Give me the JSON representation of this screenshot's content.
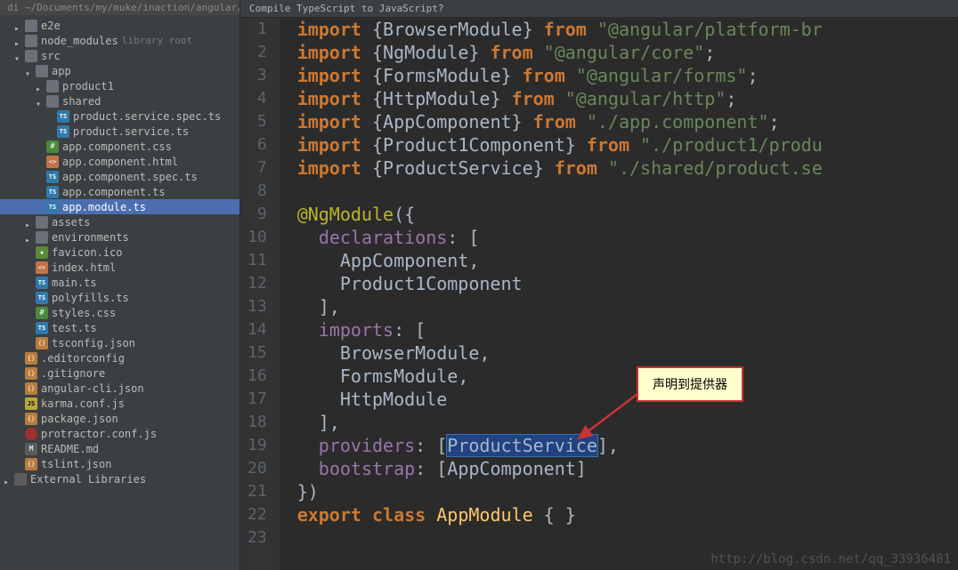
{
  "breadcrumb": "di ~/Documents/my/muke/inaction/angular/code/",
  "hint": "Compile TypeScript to JavaScript?",
  "tree": [
    {
      "label": "e2e",
      "icon": "folder",
      "arrow": "right",
      "indent": 1
    },
    {
      "label": "node_modules",
      "sublabel": "library root",
      "icon": "folder",
      "arrow": "right",
      "indent": 1
    },
    {
      "label": "src",
      "icon": "folder",
      "arrow": "down",
      "indent": 1
    },
    {
      "label": "app",
      "icon": "folder",
      "arrow": "down",
      "indent": 2
    },
    {
      "label": "product1",
      "icon": "folder",
      "arrow": "right",
      "indent": 3
    },
    {
      "label": "shared",
      "icon": "folder",
      "arrow": "down",
      "indent": 3
    },
    {
      "label": "product.service.spec.ts",
      "icon": "ts",
      "arrow": "none",
      "indent": 4
    },
    {
      "label": "product.service.ts",
      "icon": "ts",
      "arrow": "none",
      "indent": 4
    },
    {
      "label": "app.component.css",
      "icon": "css",
      "arrow": "none",
      "indent": 3
    },
    {
      "label": "app.component.html",
      "icon": "html",
      "arrow": "none",
      "indent": 3
    },
    {
      "label": "app.component.spec.ts",
      "icon": "ts",
      "arrow": "none",
      "indent": 3
    },
    {
      "label": "app.component.ts",
      "icon": "ts",
      "arrow": "none",
      "indent": 3
    },
    {
      "label": "app.module.ts",
      "icon": "ts",
      "arrow": "none",
      "indent": 3,
      "selected": true
    },
    {
      "label": "assets",
      "icon": "folder",
      "arrow": "right",
      "indent": 2
    },
    {
      "label": "environments",
      "icon": "folder",
      "arrow": "right",
      "indent": 2
    },
    {
      "label": "favicon.ico",
      "icon": "ico",
      "arrow": "none",
      "indent": 2
    },
    {
      "label": "index.html",
      "icon": "html",
      "arrow": "none",
      "indent": 2
    },
    {
      "label": "main.ts",
      "icon": "ts",
      "arrow": "none",
      "indent": 2
    },
    {
      "label": "polyfills.ts",
      "icon": "ts",
      "arrow": "none",
      "indent": 2
    },
    {
      "label": "styles.css",
      "icon": "css",
      "arrow": "none",
      "indent": 2
    },
    {
      "label": "test.ts",
      "icon": "ts",
      "arrow": "none",
      "indent": 2
    },
    {
      "label": "tsconfig.json",
      "icon": "json",
      "arrow": "none",
      "indent": 2
    },
    {
      "label": ".editorconfig",
      "icon": "json",
      "arrow": "none",
      "indent": 1
    },
    {
      "label": ".gitignore",
      "icon": "json",
      "arrow": "none",
      "indent": 1
    },
    {
      "label": "angular-cli.json",
      "icon": "json",
      "arrow": "none",
      "indent": 1
    },
    {
      "label": "karma.conf.js",
      "icon": "js",
      "arrow": "none",
      "indent": 1
    },
    {
      "label": "package.json",
      "icon": "json",
      "arrow": "none",
      "indent": 1
    },
    {
      "label": "protractor.conf.js",
      "icon": "red",
      "arrow": "none",
      "indent": 1
    },
    {
      "label": "README.md",
      "icon": "md",
      "arrow": "none",
      "indent": 1
    },
    {
      "label": "tslint.json",
      "icon": "json",
      "arrow": "none",
      "indent": 1
    },
    {
      "label": "External Libraries",
      "icon": "lib",
      "arrow": "right",
      "indent": 0
    }
  ],
  "code": {
    "lines": [
      {
        "n": 1,
        "tokens": [
          [
            "kw",
            "import"
          ],
          [
            "punct",
            " {"
          ],
          [
            "ident",
            "BrowserModule"
          ],
          [
            "punct",
            "} "
          ],
          [
            "kw",
            "from"
          ],
          [
            "punct",
            " "
          ],
          [
            "str",
            "\"@angular/platform-br"
          ]
        ]
      },
      {
        "n": 2,
        "tokens": [
          [
            "kw",
            "import"
          ],
          [
            "punct",
            " {"
          ],
          [
            "ident",
            "NgModule"
          ],
          [
            "punct",
            "} "
          ],
          [
            "kw",
            "from"
          ],
          [
            "punct",
            " "
          ],
          [
            "str",
            "\"@angular/core\""
          ],
          [
            "punct",
            ";"
          ]
        ]
      },
      {
        "n": 3,
        "tokens": [
          [
            "kw",
            "import"
          ],
          [
            "punct",
            " {"
          ],
          [
            "ident",
            "FormsModule"
          ],
          [
            "punct",
            "} "
          ],
          [
            "kw",
            "from"
          ],
          [
            "punct",
            " "
          ],
          [
            "str",
            "\"@angular/forms\""
          ],
          [
            "punct",
            ";"
          ]
        ]
      },
      {
        "n": 4,
        "tokens": [
          [
            "kw",
            "import"
          ],
          [
            "punct",
            " {"
          ],
          [
            "ident",
            "HttpModule"
          ],
          [
            "punct",
            "} "
          ],
          [
            "kw",
            "from"
          ],
          [
            "punct",
            " "
          ],
          [
            "str",
            "\"@angular/http\""
          ],
          [
            "punct",
            ";"
          ]
        ]
      },
      {
        "n": 5,
        "tokens": [
          [
            "kw",
            "import"
          ],
          [
            "punct",
            " {"
          ],
          [
            "ident",
            "AppComponent"
          ],
          [
            "punct",
            "} "
          ],
          [
            "kw",
            "from"
          ],
          [
            "punct",
            " "
          ],
          [
            "str",
            "\"./app.component\""
          ],
          [
            "punct",
            ";"
          ]
        ]
      },
      {
        "n": 6,
        "tokens": [
          [
            "kw",
            "import"
          ],
          [
            "punct",
            " {"
          ],
          [
            "ident",
            "Product1Component"
          ],
          [
            "punct",
            "} "
          ],
          [
            "kw",
            "from"
          ],
          [
            "punct",
            " "
          ],
          [
            "str",
            "\"./product1/produ"
          ]
        ]
      },
      {
        "n": 7,
        "tokens": [
          [
            "kw",
            "import"
          ],
          [
            "punct",
            " {"
          ],
          [
            "ident",
            "ProductService"
          ],
          [
            "punct",
            "} "
          ],
          [
            "kw",
            "from"
          ],
          [
            "punct",
            " "
          ],
          [
            "str",
            "\"./shared/product.se"
          ]
        ]
      },
      {
        "n": 8,
        "tokens": []
      },
      {
        "n": 9,
        "tokens": [
          [
            "decor",
            "@NgModule"
          ],
          [
            "punct",
            "({"
          ]
        ]
      },
      {
        "n": 10,
        "tokens": [
          [
            "punct",
            "  "
          ],
          [
            "prop",
            "declarations"
          ],
          [
            "punct",
            ": ["
          ]
        ]
      },
      {
        "n": 11,
        "tokens": [
          [
            "punct",
            "    "
          ],
          [
            "ident",
            "AppComponent"
          ],
          [
            "punct",
            ","
          ]
        ]
      },
      {
        "n": 12,
        "tokens": [
          [
            "punct",
            "    "
          ],
          [
            "ident",
            "Product1Component"
          ]
        ]
      },
      {
        "n": 13,
        "tokens": [
          [
            "punct",
            "  ],"
          ]
        ]
      },
      {
        "n": 14,
        "tokens": [
          [
            "punct",
            "  "
          ],
          [
            "prop",
            "imports"
          ],
          [
            "punct",
            ": ["
          ]
        ]
      },
      {
        "n": 15,
        "tokens": [
          [
            "punct",
            "    "
          ],
          [
            "ident",
            "BrowserModule"
          ],
          [
            "punct",
            ","
          ]
        ]
      },
      {
        "n": 16,
        "tokens": [
          [
            "punct",
            "    "
          ],
          [
            "ident",
            "FormsModule"
          ],
          [
            "punct",
            ","
          ]
        ]
      },
      {
        "n": 17,
        "tokens": [
          [
            "punct",
            "    "
          ],
          [
            "ident",
            "HttpModule"
          ]
        ]
      },
      {
        "n": 18,
        "tokens": [
          [
            "punct",
            "  ],"
          ]
        ]
      },
      {
        "n": 19,
        "tokens": [
          [
            "punct",
            "  "
          ],
          [
            "prop",
            "providers"
          ],
          [
            "punct",
            ": ["
          ],
          [
            "ident-sel",
            "ProductService"
          ],
          [
            "punct",
            "],"
          ]
        ]
      },
      {
        "n": 20,
        "tokens": [
          [
            "punct",
            "  "
          ],
          [
            "prop",
            "bootstrap"
          ],
          [
            "punct",
            ": ["
          ],
          [
            "ident",
            "AppComponent"
          ],
          [
            "punct",
            "]"
          ]
        ]
      },
      {
        "n": 21,
        "tokens": [
          [
            "punct",
            "})"
          ]
        ]
      },
      {
        "n": 22,
        "tokens": [
          [
            "kw",
            "export"
          ],
          [
            "punct",
            " "
          ],
          [
            "kw",
            "class"
          ],
          [
            "punct",
            " "
          ],
          [
            "type",
            "AppModule"
          ],
          [
            "punct",
            " { }"
          ]
        ]
      },
      {
        "n": 23,
        "tokens": []
      }
    ]
  },
  "callout": {
    "text": "声明到提供器"
  },
  "watermark": "http://blog.csdn.net/qq_33936481"
}
